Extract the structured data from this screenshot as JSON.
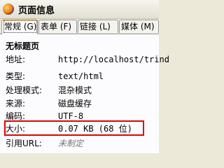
{
  "window": {
    "title": "页面信息",
    "icon": "firefox-icon"
  },
  "tabs": [
    {
      "label": "常规 (G)",
      "active": true
    },
    {
      "label": "表单 (F)",
      "active": false
    },
    {
      "label": "链接 (L)",
      "active": false
    },
    {
      "label": "媒体 (M)",
      "active": false
    }
  ],
  "general": {
    "page_title": "无标题页",
    "rows": {
      "address": {
        "label": "地址:",
        "value": "http://localhost/trind"
      },
      "type": {
        "label": "类型:",
        "value": "text/html"
      },
      "render_mode": {
        "label": "处理模式:",
        "value": "混杂模式"
      },
      "source": {
        "label": "来源:",
        "value": "磁盘缓存"
      },
      "encoding": {
        "label": "编码:",
        "value": "UTF-8"
      },
      "size": {
        "label": "大小:",
        "value": "0.07 KB (68 位)"
      },
      "referrer": {
        "label": "引用URL:",
        "value": "未制定"
      }
    }
  },
  "colors": {
    "highlight": "#e60000",
    "active_tab_accent": "#f5b64a"
  }
}
